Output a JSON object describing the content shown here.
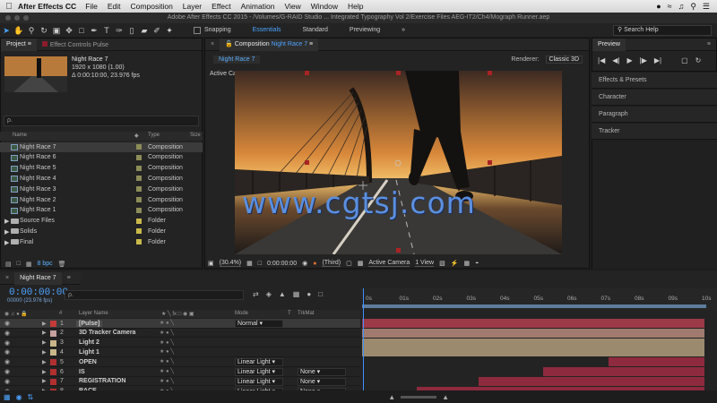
{
  "menubar": {
    "app": "After Effects CC",
    "items": [
      "File",
      "Edit",
      "Composition",
      "Layer",
      "Effect",
      "Animation",
      "View",
      "Window",
      "Help"
    ]
  },
  "titlebar": {
    "title": "Adobe After Effects CC 2015 - /Volumes/G-RAID Studio ... Integrated Typography Vol 2/Exercise Files AEG-IT2/Ch4/Mograph Runner.aep"
  },
  "toolbar": {
    "snapping": "Snapping",
    "workspaces": [
      "Essentials",
      "Standard",
      "Previewing"
    ],
    "search_help": "Search Help"
  },
  "project": {
    "tab": "Project",
    "effect_controls_tab": "Effect Controls Pulse",
    "selected_name": "Night Race 7",
    "selected_size": "1920 x 1080 (1.00)",
    "selected_duration": "Δ 0:00:10:00, 23.976 fps",
    "search_placeholder": "ρ.",
    "col_name": "Name",
    "col_type": "Type",
    "col_size": "Size",
    "items": [
      {
        "name": "Night Race 7",
        "type": "Composition",
        "kind": "comp",
        "color": "#8c8c5a"
      },
      {
        "name": "Night Race 6",
        "type": "Composition",
        "kind": "comp",
        "color": "#8c8c5a"
      },
      {
        "name": "Night Race 5",
        "type": "Composition",
        "kind": "comp",
        "color": "#8c8c5a"
      },
      {
        "name": "Night Race 4",
        "type": "Composition",
        "kind": "comp",
        "color": "#8c8c5a"
      },
      {
        "name": "Night Race 3",
        "type": "Composition",
        "kind": "comp",
        "color": "#8c8c5a"
      },
      {
        "name": "Night Race 2",
        "type": "Composition",
        "kind": "comp",
        "color": "#8c8c5a"
      },
      {
        "name": "Night Race 1",
        "type": "Composition",
        "kind": "comp",
        "color": "#8c8c5a"
      },
      {
        "name": "Source Files",
        "type": "Folder",
        "kind": "folder",
        "color": "#c9b94b"
      },
      {
        "name": "Solids",
        "type": "Folder",
        "kind": "folder",
        "color": "#c9b94b"
      },
      {
        "name": "Final",
        "type": "Folder",
        "kind": "folder",
        "color": "#c9b94b"
      }
    ],
    "bpc": "8 bpc"
  },
  "composition": {
    "tab_prefix": "Composition",
    "tab_name": "Night Race 7",
    "crumb": "Night Race 7",
    "renderer_label": "Renderer:",
    "renderer_value": "Classic 3D",
    "active_camera": "Active Camera",
    "watermark": "www.cgtsj.com",
    "zoom": "(30.4%)",
    "timecode": "0:00:00:00",
    "resolution": "(Third)",
    "camera": "Active Camera",
    "views": "1 View"
  },
  "preview": {
    "tab": "Preview"
  },
  "side_panels": [
    "Effects & Presets",
    "Character",
    "Paragraph",
    "Tracker"
  ],
  "timeline": {
    "tab": "Night Race 7",
    "time": "0:00:00:00",
    "fps": "00000 (23.976 fps)",
    "col_layer_name": "Layer Name",
    "col_mode": "Mode",
    "col_t": "T",
    "col_trkmat": "TrkMat",
    "ruler": [
      "0s",
      "01s",
      "02s",
      "03s",
      "04s",
      "05s",
      "06s",
      "07s",
      "08s",
      "09s",
      "10s"
    ],
    "layers": [
      {
        "num": "1",
        "name": "[Pulse]",
        "color": "#c43a3a",
        "mode": "Normal",
        "trkmat": ""
      },
      {
        "num": "2",
        "name": "3D Tracker Camera",
        "color": "#c7a0a0",
        "mode": "",
        "trkmat": ""
      },
      {
        "num": "3",
        "name": "Light 2",
        "color": "#c9b58a",
        "mode": "",
        "trkmat": ""
      },
      {
        "num": "4",
        "name": "Light 1",
        "color": "#c9b58a",
        "mode": "",
        "trkmat": ""
      },
      {
        "num": "5",
        "name": "OPEN",
        "color": "#b03030",
        "mode": "Linear Light",
        "trkmat": ""
      },
      {
        "num": "6",
        "name": "IS",
        "color": "#b03030",
        "mode": "Linear Light",
        "trkmat": "None"
      },
      {
        "num": "7",
        "name": "REGISTRATION",
        "color": "#b03030",
        "mode": "Linear Light",
        "trkmat": "None"
      },
      {
        "num": "8",
        "name": "RACE",
        "color": "#b03030",
        "mode": "Linear Light",
        "trkmat": "None"
      }
    ],
    "bars": [
      {
        "start": 0.0,
        "end": 1.0,
        "color": "#9c3a48"
      },
      {
        "start": 0.0,
        "end": 1.0,
        "color": "#a07a6e"
      },
      {
        "start": 0.0,
        "end": 1.0,
        "color": "#9c8a6e"
      },
      {
        "start": 0.0,
        "end": 1.0,
        "color": "#9c8a6e"
      },
      {
        "start": 0.72,
        "end": 1.0,
        "color": "#8e2a3e"
      },
      {
        "start": 0.53,
        "end": 1.0,
        "color": "#8e2a3e"
      },
      {
        "start": 0.34,
        "end": 1.0,
        "color": "#8e2a3e"
      },
      {
        "start": 0.16,
        "end": 1.0,
        "color": "#8e2a3e"
      }
    ]
  }
}
